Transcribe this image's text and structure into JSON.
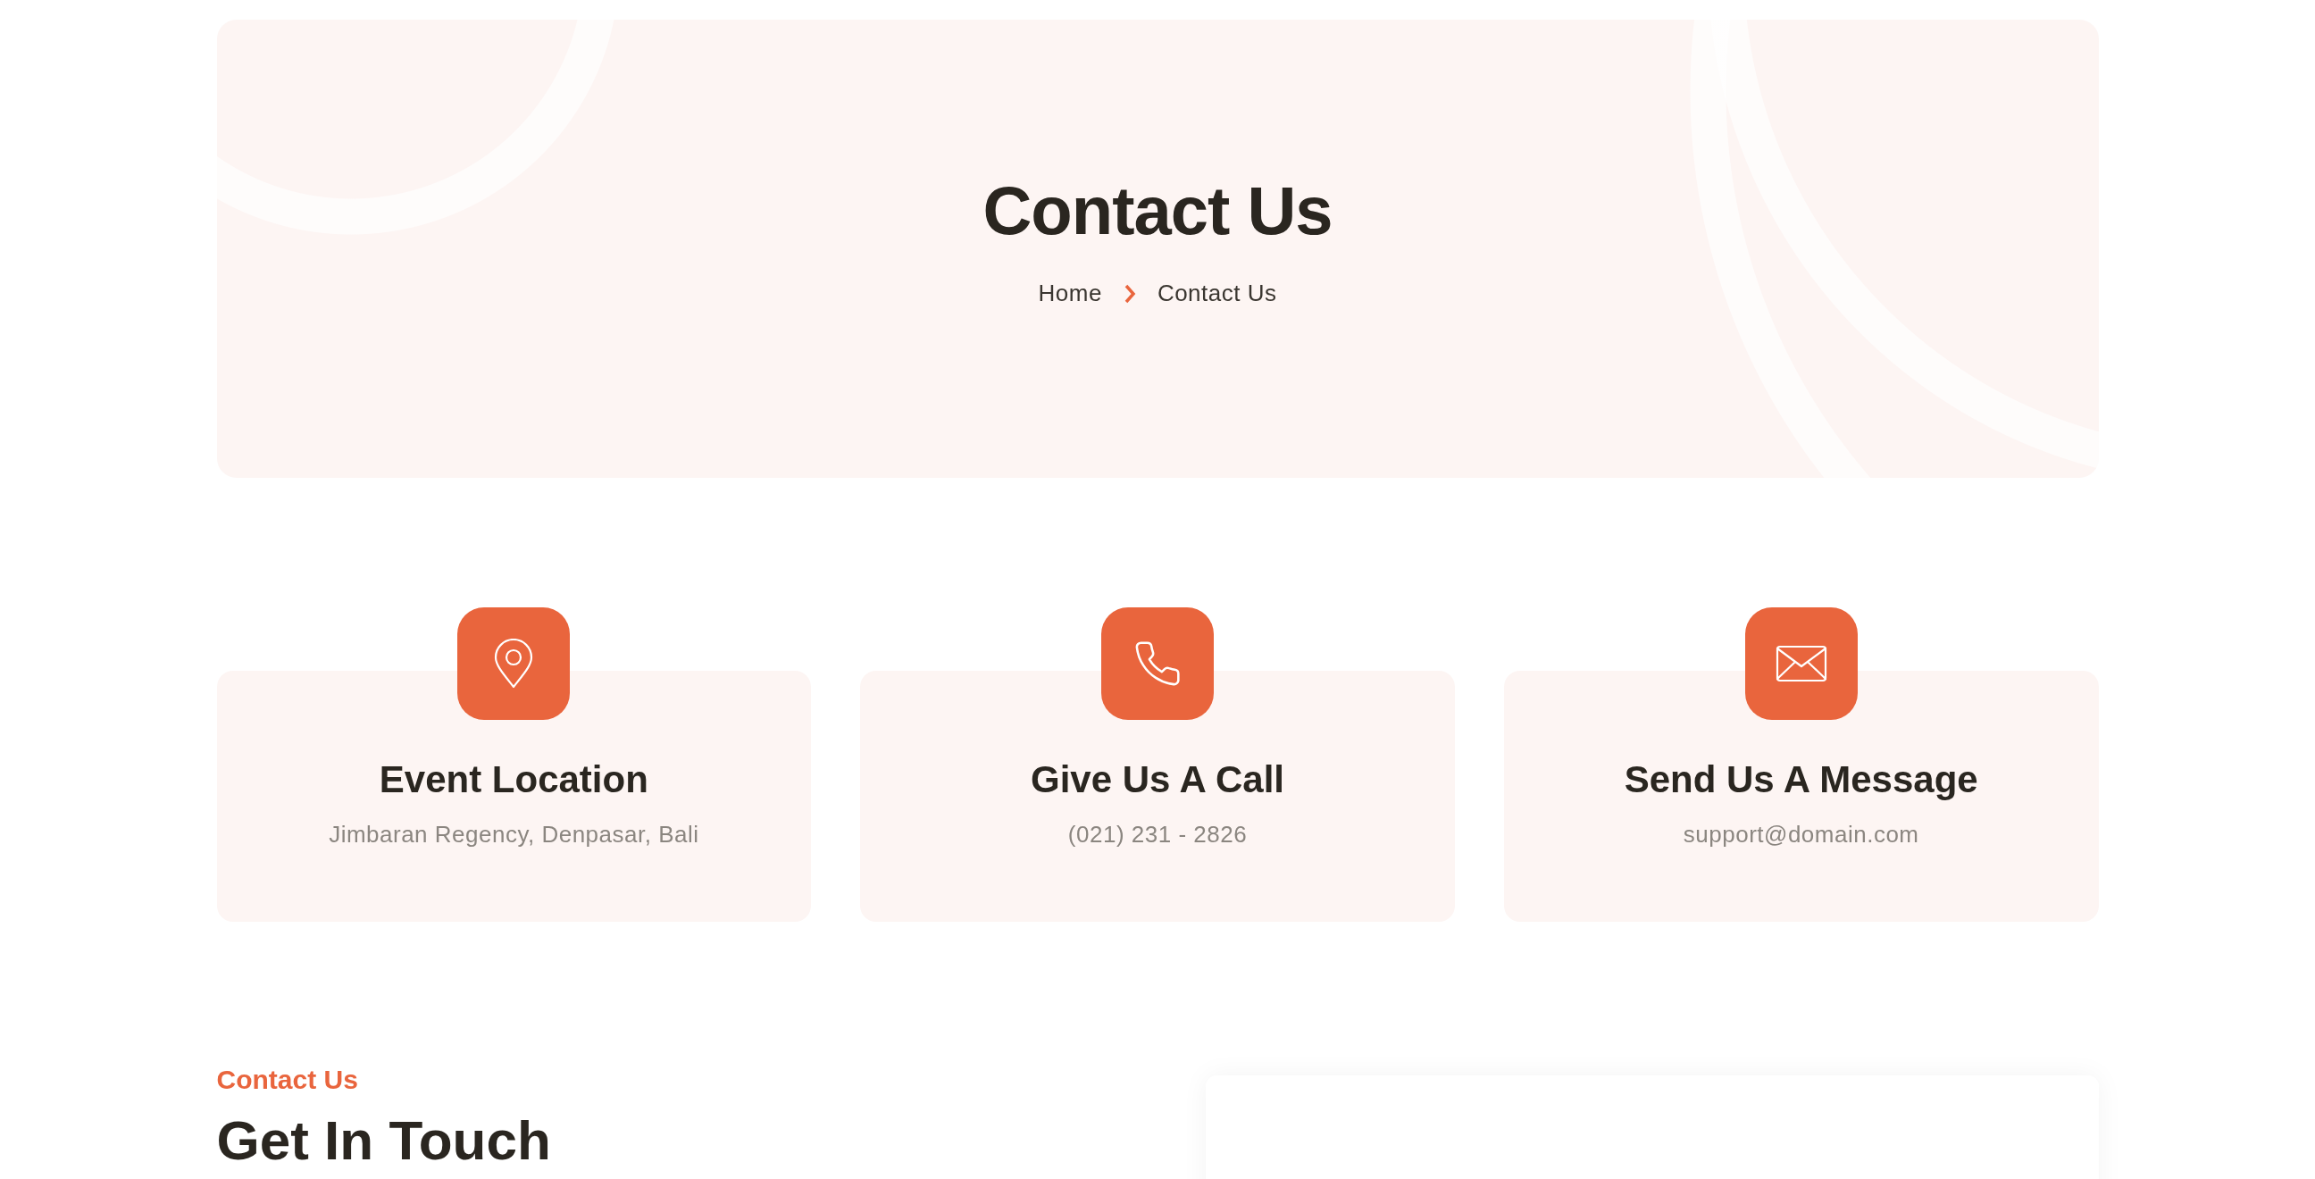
{
  "hero": {
    "title": "Contact Us",
    "breadcrumb": [
      {
        "label": "Home"
      },
      {
        "label": "Contact Us"
      }
    ]
  },
  "info_cards": [
    {
      "kind": "location",
      "title": "Event Location",
      "text": "Jimbaran Regency, Denpasar, Bali"
    },
    {
      "kind": "phone",
      "title": "Give Us A Call",
      "text": "(021) 231 - 2826"
    },
    {
      "kind": "mail",
      "title": "Send Us A Message",
      "text": "support@domain.com"
    }
  ],
  "contact_section": {
    "eyebrow": "Contact Us",
    "heading": "Get In Touch"
  }
}
